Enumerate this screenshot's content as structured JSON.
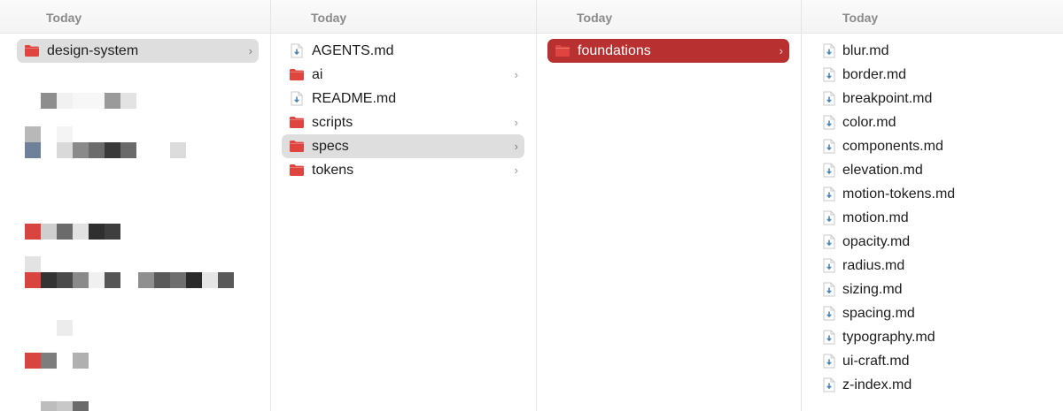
{
  "columns": [
    {
      "header": "Today",
      "items": [
        {
          "label": "design-system",
          "type": "folder",
          "has_children": true,
          "state": "selected-grey"
        }
      ]
    },
    {
      "header": "Today",
      "items": [
        {
          "label": "AGENTS.md",
          "type": "file"
        },
        {
          "label": "ai",
          "type": "folder",
          "has_children": true
        },
        {
          "label": "README.md",
          "type": "file"
        },
        {
          "label": "scripts",
          "type": "folder",
          "has_children": true
        },
        {
          "label": "specs",
          "type": "folder",
          "has_children": true,
          "state": "selected-grey"
        },
        {
          "label": "tokens",
          "type": "folder",
          "has_children": true
        }
      ]
    },
    {
      "header": "Today",
      "items": [
        {
          "label": "foundations",
          "type": "folder",
          "has_children": true,
          "state": "selected-red"
        }
      ]
    },
    {
      "header": "Today",
      "items": [
        {
          "label": "blur.md",
          "type": "file"
        },
        {
          "label": "border.md",
          "type": "file"
        },
        {
          "label": "breakpoint.md",
          "type": "file"
        },
        {
          "label": "color.md",
          "type": "file"
        },
        {
          "label": "components.md",
          "type": "file"
        },
        {
          "label": "elevation.md",
          "type": "file"
        },
        {
          "label": "motion-tokens.md",
          "type": "file"
        },
        {
          "label": "motion.md",
          "type": "file"
        },
        {
          "label": "opacity.md",
          "type": "file"
        },
        {
          "label": "radius.md",
          "type": "file"
        },
        {
          "label": "sizing.md",
          "type": "file"
        },
        {
          "label": "spacing.md",
          "type": "file"
        },
        {
          "label": "typography.md",
          "type": "file"
        },
        {
          "label": "ui-craft.md",
          "type": "file"
        },
        {
          "label": "z-index.md",
          "type": "file"
        }
      ]
    }
  ],
  "icons": {
    "folder": "folder-icon",
    "file": "markdown-file-icon",
    "chevron": "chevron-right-icon"
  },
  "colors": {
    "folder_red": "#e0443e",
    "selection_red": "#b8302f",
    "selection_grey": "#dedede",
    "header_text": "#8a8a8a",
    "file_arrow": "#4a86b3"
  }
}
